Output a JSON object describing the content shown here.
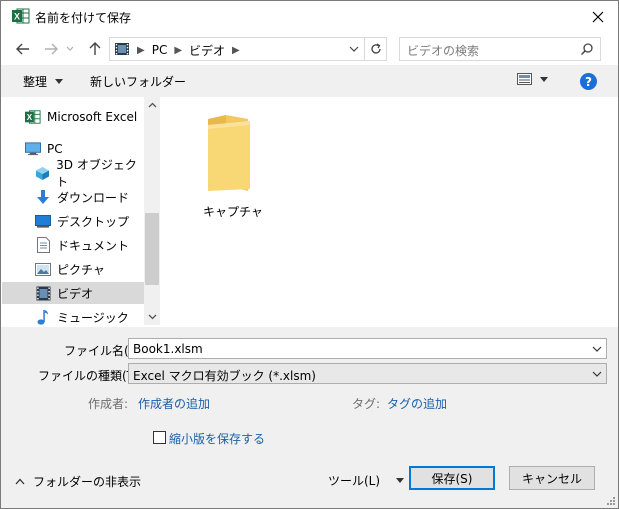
{
  "window": {
    "title": "名前を付けて保存"
  },
  "address": {
    "crumbs": [
      "PC",
      "ビデオ"
    ],
    "search_placeholder": "ビデオの検索"
  },
  "toolbar": {
    "organize": "整理",
    "new_folder": "新しいフォルダー"
  },
  "nav": {
    "items": [
      {
        "label": "Microsoft Excel",
        "icon": "excel-icon"
      },
      {
        "label": "PC",
        "icon": "pc-icon"
      },
      {
        "label": "3D オブジェクト",
        "icon": "3d-objects-icon"
      },
      {
        "label": "ダウンロード",
        "icon": "download-icon"
      },
      {
        "label": "デスクトップ",
        "icon": "desktop-icon"
      },
      {
        "label": "ドキュメント",
        "icon": "document-icon"
      },
      {
        "label": "ピクチャ",
        "icon": "pictures-icon"
      },
      {
        "label": "ビデオ",
        "icon": "video-icon",
        "selected": true
      },
      {
        "label": "ミュージック",
        "icon": "music-icon"
      }
    ]
  },
  "content": {
    "items": [
      {
        "label": "キャプチャ",
        "icon": "folder-icon"
      }
    ]
  },
  "form": {
    "filename_label": "ファイル名(N):",
    "filename_value": "Book1.xlsm",
    "filetype_label": "ファイルの種類(T):",
    "filetype_value": "Excel マクロ有効ブック (*.xlsm)",
    "authors_label": "作成者:",
    "authors_link": "作成者の追加",
    "tags_label": "タグ:",
    "tags_link": "タグの追加",
    "thumbnail_label": "縮小版を保存する"
  },
  "footer": {
    "hide_folders": "フォルダーの非表示",
    "tools": "ツール(L)",
    "save": "保存(S)",
    "cancel": "キャンセル"
  },
  "colors": {
    "accent": "#0078d7",
    "link": "#1a5fa8",
    "excel_green": "#1d7044",
    "folder": "#f8d775"
  }
}
